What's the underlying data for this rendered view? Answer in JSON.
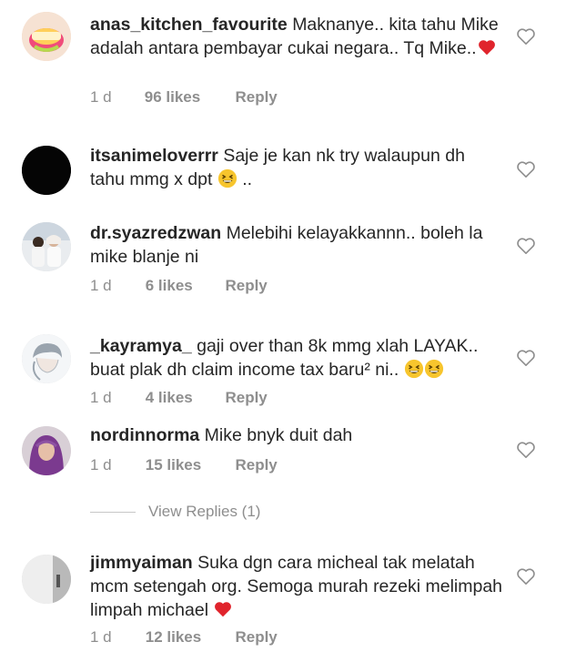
{
  "comments": [
    {
      "username": "anas_kitchen_favourite",
      "text": "Maknanye.. kita tahu Mike adalah antara pembayar cukai negara.. Tq Mike..",
      "emoji": "red-heart",
      "time": "1 d",
      "likes": "96 likes",
      "reply": "Reply"
    },
    {
      "username": "itsanimeloverrr",
      "text": "Saje je kan nk try walaupun dh tahu mmg x dpt",
      "emoji": "grinning-squint",
      "trailing_text": " .."
    },
    {
      "username": "dr.syazredzwan",
      "text": "Melebihi kelayakkannn.. boleh la mike blanje ni",
      "time": "1 d",
      "likes": "6 likes",
      "reply": "Reply"
    },
    {
      "username": "_kayramya_",
      "text": "gaji over than 8k mmg xlah LAYAK.. buat plak dh claim income tax baru² ni..",
      "emoji": "grinning-squint",
      "time": "1 d",
      "likes": "4 likes",
      "reply": "Reply"
    },
    {
      "username": "nordinnorma",
      "text": "Mike bnyk duit dah",
      "time": "1 d",
      "likes": "15 likes",
      "reply": "Reply"
    },
    {
      "username": "jimmyaiman",
      "text": "Suka dgn cara micheal  tak melatah mcm setengah org. Semoga murah rezeki melimpah limpah michael",
      "emoji": "red-heart",
      "time": "1 d",
      "likes": "12 likes",
      "reply": "Reply"
    }
  ],
  "view_replies": "View Replies (1)",
  "colors": {
    "text": "#262626",
    "meta": "#8e8e8e",
    "heart_outline": "#8e8e8e",
    "red_heart": "#e0242c",
    "emoji_yellow": "#f7c52d"
  },
  "icons": {
    "like": "heart-outline-icon",
    "red_heart": "red-heart-emoji",
    "grin": "grinning-squinting-face-emoji"
  }
}
